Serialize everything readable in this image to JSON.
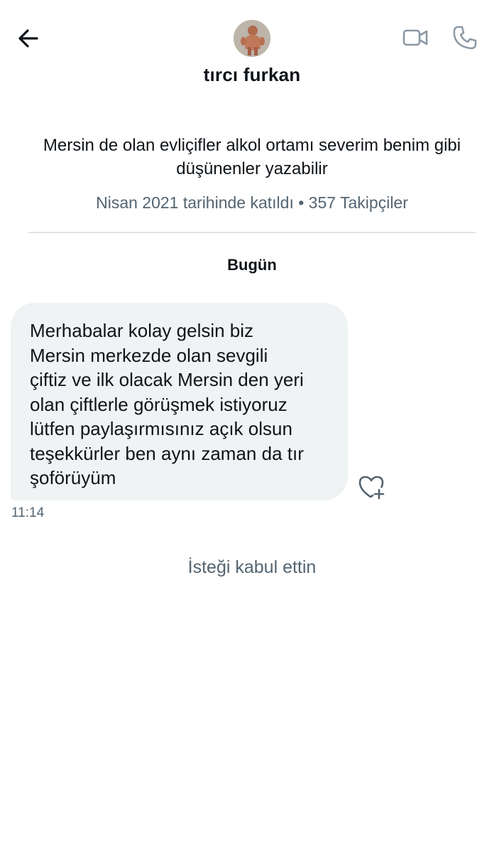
{
  "header": {
    "back_icon": "arrow-left-icon",
    "video_icon": "video-camera-icon",
    "call_icon": "phone-icon",
    "avatar_icon": "user-avatar"
  },
  "profile": {
    "name": "tırcı furkan",
    "bio": "Mersin de olan evliçifler alkol ortamı severim benim gibi düşünenler yazabilir",
    "meta": "Nisan 2021 tarihinde katıldı • 357 Takipçiler"
  },
  "conversation": {
    "day_label": "Bugün",
    "messages": [
      {
        "text": "Merhabalar kolay gelsin biz\nMersin merkezde olan sevgili\nçiftiz ve ilk olacak Mersin den yeri\nolan çiftlerle görüşmek istiyoruz\nlütfen paylaşırmısınız açık olsun\nteşekkürler ben aynı zaman da tır\nşoförüyüm",
        "time": "11:14",
        "reaction_icon": "heart-plus-icon"
      }
    ],
    "status": "İsteği kabul ettin"
  },
  "colors": {
    "text_primary": "#0f1419",
    "text_secondary": "#536471",
    "bubble_bg": "#eff3f4",
    "icon_gray": "#8b98a5",
    "divider": "#dfe3e6"
  }
}
